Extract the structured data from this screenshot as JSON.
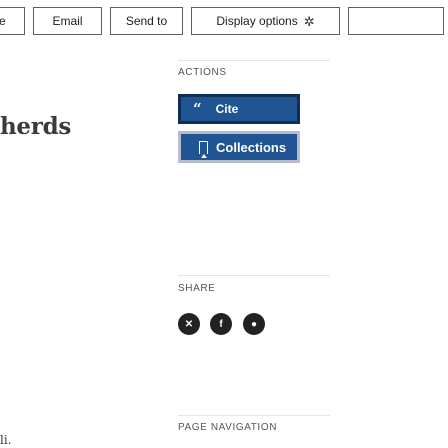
{
  "toolbar": {
    "partial_label": "e",
    "email_label": "Email",
    "send_to_label": "Send to",
    "display_options_label": "Display options",
    "display_options_icon": "gear-icon"
  },
  "article": {
    "title_fragment": "herds",
    "bottom_fragment": "li."
  },
  "actions": {
    "section_label": "ACTIONS",
    "cite_label": "Cite",
    "cite_icon": "quote-icon",
    "collections_label": "Collections",
    "collections_icon": "bookmark-icon",
    "primary_color": "#205493"
  },
  "share": {
    "section_label": "SHARE",
    "icons": [
      "x-twitter-icon",
      "facebook-icon",
      "reddit-icon"
    ]
  },
  "page_navigation": {
    "section_label": "PAGE NAVIGATION"
  }
}
